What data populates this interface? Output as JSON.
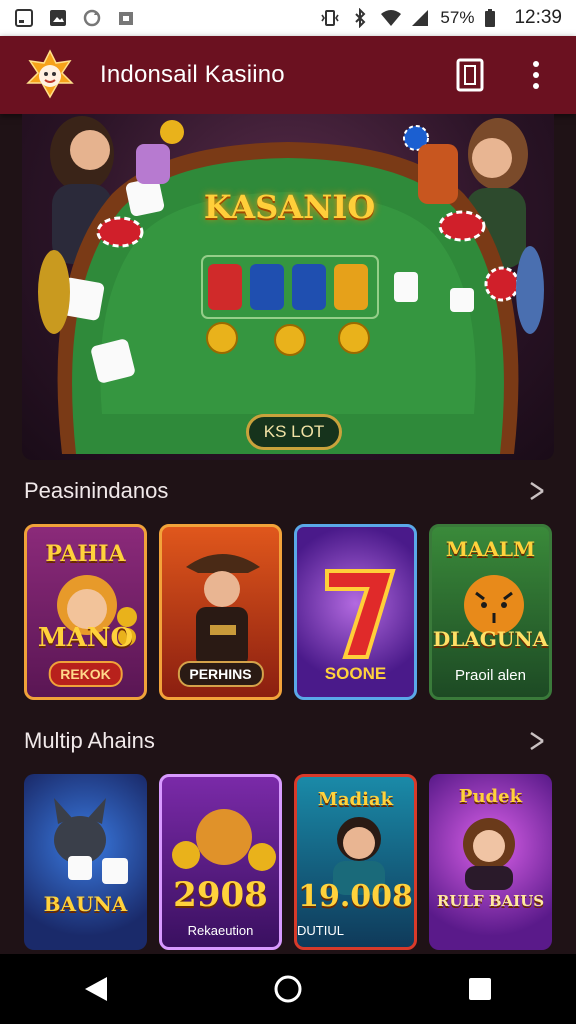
{
  "status_bar": {
    "battery_text": "57%",
    "time": "12:39"
  },
  "app_bar": {
    "title": "Indonsail Kasiino"
  },
  "hero": {
    "logo_text": "KASANIO",
    "badge": "KS LOT"
  },
  "sections": [
    {
      "title": "Peasinindanos",
      "cards": [
        {
          "title_top": "PAHIA",
          "title_bottom": "MANO",
          "tag": "REKOK"
        },
        {
          "title_top": "",
          "title_bottom": "",
          "tag": "PERHINS"
        },
        {
          "title_top": "",
          "title_bottom": "",
          "tag": "SOONE"
        },
        {
          "title_top": "MAALM",
          "title_bottom": "DLAGUNA",
          "tag": "Praoil alen"
        }
      ]
    },
    {
      "title": "Multip Ahains",
      "cards": [
        {
          "title_top": "",
          "title_bottom": "BAUNA",
          "tag": ""
        },
        {
          "title_top": "",
          "title_bottom": "2908",
          "tag": "Rekaeution"
        },
        {
          "title_top": "Madiak",
          "title_bottom": "19.008",
          "tag": "DUTIUL"
        },
        {
          "title_top": "Pudek",
          "title_bottom": "RULF BAIUS",
          "tag": ""
        }
      ]
    }
  ],
  "colors": {
    "app_bar": "#6b1120",
    "background": "#1f1216",
    "felt": "#2f8a3a",
    "gold": "#ffcf3a"
  }
}
